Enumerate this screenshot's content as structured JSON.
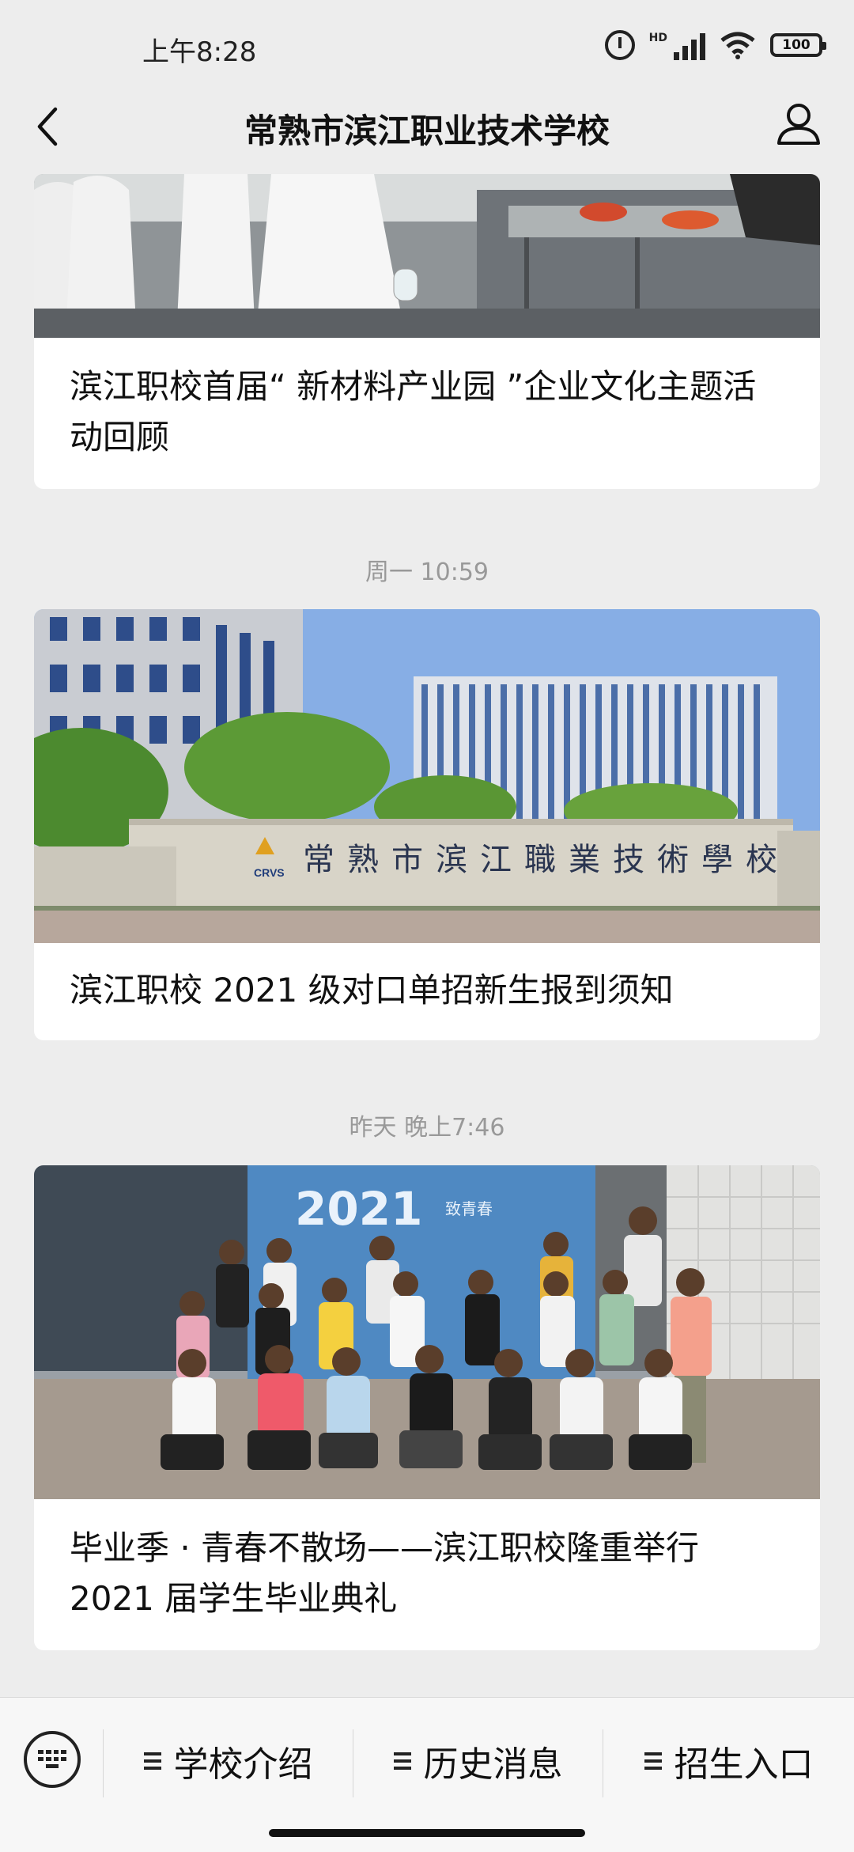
{
  "status": {
    "time": "上午8:28",
    "network": "HD",
    "battery": "100"
  },
  "nav": {
    "title": "常熟市滨江职业技术学校"
  },
  "articles": [
    {
      "caption": "滨江职校首届“ 新材料产业园 ”企业文化主题活动回顾",
      "image_icon": "lab-photo-icon"
    },
    {
      "timestamp": "周一 10:59",
      "caption": "滨江职校 2021 级对口单招新生报到须知",
      "image_icon": "campus-gate-photo-icon",
      "gate_text": "常熟市滨江職業技術學校",
      "logo_text": "CRVS"
    },
    {
      "timestamp": "昨天 晚上7:46",
      "caption": "毕业季 · 青春不散场——滨江职校隆重举行 2021 届学生毕业典礼",
      "image_icon": "graduation-photo-icon",
      "banner_text": "2021",
      "banner_sub": "致青春"
    }
  ],
  "bottom_menu": [
    {
      "label": "学校介绍"
    },
    {
      "label": "历史消息"
    },
    {
      "label": "招生入口"
    }
  ]
}
